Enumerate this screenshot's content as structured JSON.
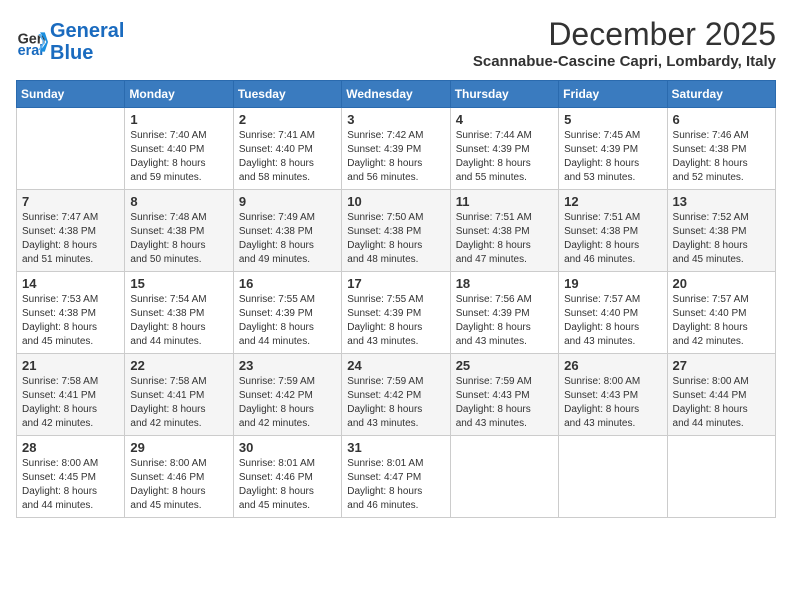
{
  "header": {
    "logo_line1": "General",
    "logo_line2": "Blue",
    "month": "December 2025",
    "location": "Scannabue-Cascine Capri, Lombardy, Italy"
  },
  "days_of_week": [
    "Sunday",
    "Monday",
    "Tuesday",
    "Wednesday",
    "Thursday",
    "Friday",
    "Saturday"
  ],
  "weeks": [
    [
      {
        "day": "",
        "info": ""
      },
      {
        "day": "1",
        "info": "Sunrise: 7:40 AM\nSunset: 4:40 PM\nDaylight: 8 hours\nand 59 minutes."
      },
      {
        "day": "2",
        "info": "Sunrise: 7:41 AM\nSunset: 4:40 PM\nDaylight: 8 hours\nand 58 minutes."
      },
      {
        "day": "3",
        "info": "Sunrise: 7:42 AM\nSunset: 4:39 PM\nDaylight: 8 hours\nand 56 minutes."
      },
      {
        "day": "4",
        "info": "Sunrise: 7:44 AM\nSunset: 4:39 PM\nDaylight: 8 hours\nand 55 minutes."
      },
      {
        "day": "5",
        "info": "Sunrise: 7:45 AM\nSunset: 4:39 PM\nDaylight: 8 hours\nand 53 minutes."
      },
      {
        "day": "6",
        "info": "Sunrise: 7:46 AM\nSunset: 4:38 PM\nDaylight: 8 hours\nand 52 minutes."
      }
    ],
    [
      {
        "day": "7",
        "info": "Sunrise: 7:47 AM\nSunset: 4:38 PM\nDaylight: 8 hours\nand 51 minutes."
      },
      {
        "day": "8",
        "info": "Sunrise: 7:48 AM\nSunset: 4:38 PM\nDaylight: 8 hours\nand 50 minutes."
      },
      {
        "day": "9",
        "info": "Sunrise: 7:49 AM\nSunset: 4:38 PM\nDaylight: 8 hours\nand 49 minutes."
      },
      {
        "day": "10",
        "info": "Sunrise: 7:50 AM\nSunset: 4:38 PM\nDaylight: 8 hours\nand 48 minutes."
      },
      {
        "day": "11",
        "info": "Sunrise: 7:51 AM\nSunset: 4:38 PM\nDaylight: 8 hours\nand 47 minutes."
      },
      {
        "day": "12",
        "info": "Sunrise: 7:51 AM\nSunset: 4:38 PM\nDaylight: 8 hours\nand 46 minutes."
      },
      {
        "day": "13",
        "info": "Sunrise: 7:52 AM\nSunset: 4:38 PM\nDaylight: 8 hours\nand 45 minutes."
      }
    ],
    [
      {
        "day": "14",
        "info": "Sunrise: 7:53 AM\nSunset: 4:38 PM\nDaylight: 8 hours\nand 45 minutes."
      },
      {
        "day": "15",
        "info": "Sunrise: 7:54 AM\nSunset: 4:38 PM\nDaylight: 8 hours\nand 44 minutes."
      },
      {
        "day": "16",
        "info": "Sunrise: 7:55 AM\nSunset: 4:39 PM\nDaylight: 8 hours\nand 44 minutes."
      },
      {
        "day": "17",
        "info": "Sunrise: 7:55 AM\nSunset: 4:39 PM\nDaylight: 8 hours\nand 43 minutes."
      },
      {
        "day": "18",
        "info": "Sunrise: 7:56 AM\nSunset: 4:39 PM\nDaylight: 8 hours\nand 43 minutes."
      },
      {
        "day": "19",
        "info": "Sunrise: 7:57 AM\nSunset: 4:40 PM\nDaylight: 8 hours\nand 43 minutes."
      },
      {
        "day": "20",
        "info": "Sunrise: 7:57 AM\nSunset: 4:40 PM\nDaylight: 8 hours\nand 42 minutes."
      }
    ],
    [
      {
        "day": "21",
        "info": "Sunrise: 7:58 AM\nSunset: 4:41 PM\nDaylight: 8 hours\nand 42 minutes."
      },
      {
        "day": "22",
        "info": "Sunrise: 7:58 AM\nSunset: 4:41 PM\nDaylight: 8 hours\nand 42 minutes."
      },
      {
        "day": "23",
        "info": "Sunrise: 7:59 AM\nSunset: 4:42 PM\nDaylight: 8 hours\nand 42 minutes."
      },
      {
        "day": "24",
        "info": "Sunrise: 7:59 AM\nSunset: 4:42 PM\nDaylight: 8 hours\nand 43 minutes."
      },
      {
        "day": "25",
        "info": "Sunrise: 7:59 AM\nSunset: 4:43 PM\nDaylight: 8 hours\nand 43 minutes."
      },
      {
        "day": "26",
        "info": "Sunrise: 8:00 AM\nSunset: 4:43 PM\nDaylight: 8 hours\nand 43 minutes."
      },
      {
        "day": "27",
        "info": "Sunrise: 8:00 AM\nSunset: 4:44 PM\nDaylight: 8 hours\nand 44 minutes."
      }
    ],
    [
      {
        "day": "28",
        "info": "Sunrise: 8:00 AM\nSunset: 4:45 PM\nDaylight: 8 hours\nand 44 minutes."
      },
      {
        "day": "29",
        "info": "Sunrise: 8:00 AM\nSunset: 4:46 PM\nDaylight: 8 hours\nand 45 minutes."
      },
      {
        "day": "30",
        "info": "Sunrise: 8:01 AM\nSunset: 4:46 PM\nDaylight: 8 hours\nand 45 minutes."
      },
      {
        "day": "31",
        "info": "Sunrise: 8:01 AM\nSunset: 4:47 PM\nDaylight: 8 hours\nand 46 minutes."
      },
      {
        "day": "",
        "info": ""
      },
      {
        "day": "",
        "info": ""
      },
      {
        "day": "",
        "info": ""
      }
    ]
  ]
}
